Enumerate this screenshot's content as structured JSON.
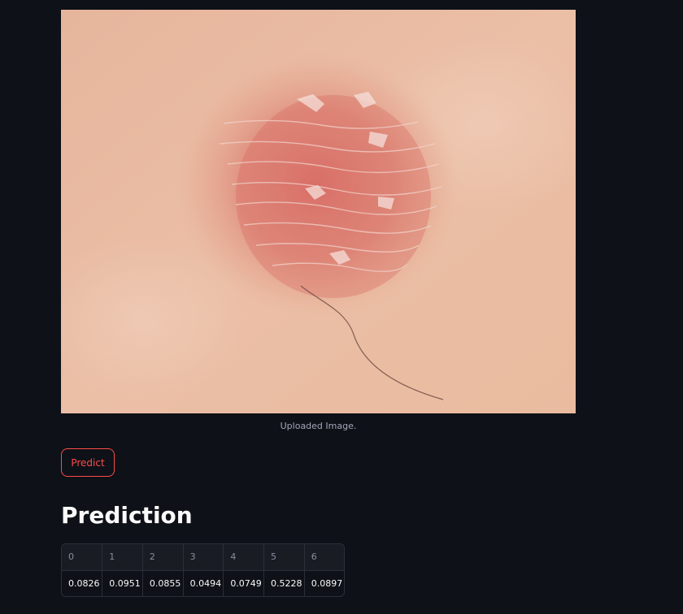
{
  "image": {
    "caption": "Uploaded Image."
  },
  "predict_button": {
    "label": "Predict"
  },
  "prediction": {
    "heading": "Prediction",
    "columns": [
      "0",
      "1",
      "2",
      "3",
      "4",
      "5",
      "6"
    ],
    "values": [
      "0.0826",
      "0.0951",
      "0.0855",
      "0.0494",
      "0.0749",
      "0.5228",
      "0.0897"
    ]
  },
  "colors": {
    "background": "#0e1117",
    "accent": "#ff4b4b",
    "text": "#fafafa",
    "muted": "#a3a8b8"
  }
}
